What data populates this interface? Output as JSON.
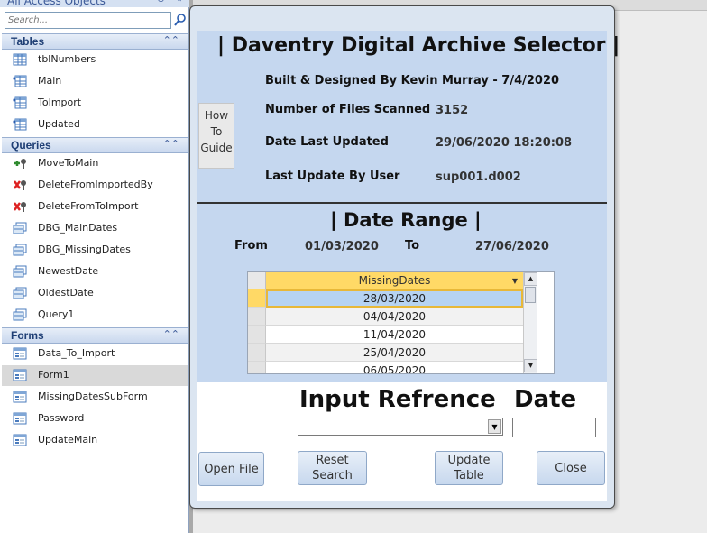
{
  "nav": {
    "title": "All Access Objects",
    "search_placeholder": "Search...",
    "groups": [
      {
        "label": "Tables",
        "items": [
          "tblNumbers",
          "Main",
          "ToImport",
          "Updated"
        ]
      },
      {
        "label": "Queries",
        "items": [
          "MoveToMain",
          "DeleteFromImportedBy",
          "DeleteFromToImport",
          "DBG_MainDates",
          "DBG_MissingDates",
          "NewestDate",
          "OldestDate",
          "Query1"
        ]
      },
      {
        "label": "Forms",
        "items": [
          "Data_To_Import",
          "Form1",
          "MissingDatesSubForm",
          "Password",
          "UpdateMain"
        ]
      }
    ],
    "selected_item": "Form1"
  },
  "form": {
    "title": "| Daventry Digital Archive Selector |",
    "built_by": "Built & Designed By Kevin Murray - 7/4/2020",
    "how_to_button": "How To Guide",
    "files_scanned_label": "Number of Files Scanned",
    "files_scanned_value": "3152",
    "date_updated_label": "Date Last Updated",
    "date_updated_value": "29/06/2020 18:20:08",
    "last_user_label": "Last Update By User",
    "last_user_value": "sup001.d002",
    "date_range_title": "| Date Range |",
    "from_label": "From",
    "from_value": "01/03/2020",
    "to_label": "To",
    "to_value": "27/06/2020",
    "datasheet": {
      "column": "MissingDates",
      "rows": [
        "28/03/2020",
        "04/04/2020",
        "11/04/2020",
        "25/04/2020",
        "06/05/2020"
      ]
    },
    "input_ref_label": "Input Refrence",
    "date_label": "Date",
    "buttons": {
      "open_file": "Open File",
      "reset_search": "Reset Search",
      "update_table": "Update Table",
      "close": "Close"
    }
  }
}
